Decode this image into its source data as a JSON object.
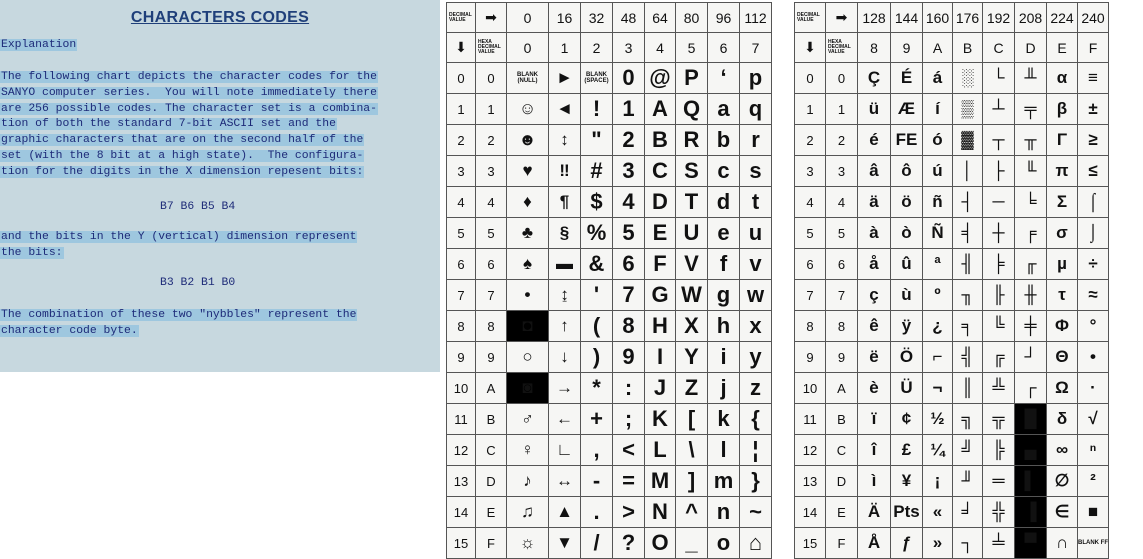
{
  "left": {
    "title": "CHARACTERS CODES",
    "subtitle": "Explanation",
    "para1_lines": [
      "The following chart depicts the character codes for the",
      "SANYO computer series.  You will note immediately there",
      "are 256 possible codes. The character set is a combina-",
      "tion of both the standard 7-bit ASCII set and the",
      "graphic characters that are on the second half of the",
      "set (with the 8 bit at a high state).  The configura-",
      "tion for the digits in the X dimension repesent bits:"
    ],
    "bits_x": "B7 B6 B5 B4",
    "para2_lines": [
      "and the bits in the Y (vertical) dimension represent",
      "the bits:"
    ],
    "bits_y": "B3 B2 B1 B0",
    "para3_lines": [
      "The combination of these two \"nybbles\" represent the",
      "character code byte."
    ]
  },
  "table1": {
    "header_label_dec": "DECIMAL VALUE",
    "header_label_hex": "HEXA DECIMAL VALUE",
    "arrow_right": "➡",
    "arrow_down": "⬇",
    "dec_cols": [
      "0",
      "16",
      "32",
      "48",
      "64",
      "80",
      "96",
      "112"
    ],
    "hex_cols": [
      "0",
      "1",
      "2",
      "3",
      "4",
      "5",
      "6",
      "7"
    ],
    "rows": [
      {
        "dec": "0",
        "hex": "0",
        "cells": [
          "BLANK (NULL)",
          "►",
          "BLANK (SPACE)",
          "0",
          "@",
          "P",
          "‘",
          "p"
        ]
      },
      {
        "dec": "1",
        "hex": "1",
        "cells": [
          "☺",
          "◄",
          "!",
          "1",
          "A",
          "Q",
          "a",
          "q"
        ]
      },
      {
        "dec": "2",
        "hex": "2",
        "cells": [
          "☻",
          "↕",
          "\"",
          "2",
          "B",
          "R",
          "b",
          "r"
        ]
      },
      {
        "dec": "3",
        "hex": "3",
        "cells": [
          "♥",
          "‼",
          "#",
          "3",
          "C",
          "S",
          "c",
          "s"
        ]
      },
      {
        "dec": "4",
        "hex": "4",
        "cells": [
          "♦",
          "¶",
          "$",
          "4",
          "D",
          "T",
          "d",
          "t"
        ]
      },
      {
        "dec": "5",
        "hex": "5",
        "cells": [
          "♣",
          "§",
          "%",
          "5",
          "E",
          "U",
          "e",
          "u"
        ]
      },
      {
        "dec": "6",
        "hex": "6",
        "cells": [
          "♠",
          "▬",
          "&",
          "6",
          "F",
          "V",
          "f",
          "v"
        ]
      },
      {
        "dec": "7",
        "hex": "7",
        "cells": [
          "•",
          "↨",
          "'",
          "7",
          "G",
          "W",
          "g",
          "w"
        ]
      },
      {
        "dec": "8",
        "hex": "8",
        "cells": [
          "◘",
          "↑",
          "(",
          "8",
          "H",
          "X",
          "h",
          "x"
        ]
      },
      {
        "dec": "9",
        "hex": "9",
        "cells": [
          "○",
          "↓",
          ")",
          "9",
          "I",
          "Y",
          "i",
          "y"
        ]
      },
      {
        "dec": "10",
        "hex": "A",
        "cells": [
          "◙",
          "→",
          "*",
          ":",
          "J",
          "Z",
          "j",
          "z"
        ]
      },
      {
        "dec": "11",
        "hex": "B",
        "cells": [
          "♂",
          "←",
          "+",
          ";",
          "K",
          "[",
          "k",
          "{"
        ]
      },
      {
        "dec": "12",
        "hex": "C",
        "cells": [
          "♀",
          "∟",
          ",",
          "<",
          "L",
          "\\",
          "l",
          "¦"
        ]
      },
      {
        "dec": "13",
        "hex": "D",
        "cells": [
          "♪",
          "↔",
          "-",
          "=",
          "M",
          "]",
          "m",
          "}"
        ]
      },
      {
        "dec": "14",
        "hex": "E",
        "cells": [
          "♫",
          "▲",
          ".",
          ">",
          "N",
          "^",
          "n",
          "~"
        ]
      },
      {
        "dec": "15",
        "hex": "F",
        "cells": [
          "☼",
          "▼",
          "/",
          "?",
          "O",
          "_",
          "o",
          "⌂"
        ]
      }
    ]
  },
  "table2": {
    "header_label_dec": "DECIMAL VALUE",
    "header_label_hex": "HEXA DECIMAL VALUE",
    "arrow_right": "➡",
    "arrow_down": "⬇",
    "dec_cols": [
      "128",
      "144",
      "160",
      "176",
      "192",
      "208",
      "224",
      "240"
    ],
    "hex_cols": [
      "8",
      "9",
      "A",
      "B",
      "C",
      "D",
      "E",
      "F"
    ],
    "rows": [
      {
        "dec": "0",
        "hex": "0",
        "cells": [
          "Ç",
          "É",
          "á",
          "░",
          "└",
          "╨",
          "α",
          "≡"
        ]
      },
      {
        "dec": "1",
        "hex": "1",
        "cells": [
          "ü",
          "Æ",
          "í",
          "▒",
          "┴",
          "╤",
          "β",
          "±"
        ]
      },
      {
        "dec": "2",
        "hex": "2",
        "cells": [
          "é",
          "FE",
          "ó",
          "▓",
          "┬",
          "╥",
          "Γ",
          "≥"
        ]
      },
      {
        "dec": "3",
        "hex": "3",
        "cells": [
          "â",
          "ô",
          "ú",
          "│",
          "├",
          "╙",
          "π",
          "≤"
        ]
      },
      {
        "dec": "4",
        "hex": "4",
        "cells": [
          "ä",
          "ö",
          "ñ",
          "┤",
          "─",
          "╘",
          "Σ",
          "⌠"
        ]
      },
      {
        "dec": "5",
        "hex": "5",
        "cells": [
          "à",
          "ò",
          "Ñ",
          "╡",
          "┼",
          "╒",
          "σ",
          "⌡"
        ]
      },
      {
        "dec": "6",
        "hex": "6",
        "cells": [
          "å",
          "û",
          "ª",
          "╢",
          "╞",
          "╓",
          "µ",
          "÷"
        ]
      },
      {
        "dec": "7",
        "hex": "7",
        "cells": [
          "ç",
          "ù",
          "º",
          "╖",
          "╟",
          "╫",
          "τ",
          "≈"
        ]
      },
      {
        "dec": "8",
        "hex": "8",
        "cells": [
          "ê",
          "ÿ",
          "¿",
          "╕",
          "╚",
          "╪",
          "Φ",
          "°"
        ]
      },
      {
        "dec": "9",
        "hex": "9",
        "cells": [
          "ë",
          "Ö",
          "⌐",
          "╣",
          "╔",
          "┘",
          "Θ",
          "•"
        ]
      },
      {
        "dec": "10",
        "hex": "A",
        "cells": [
          "è",
          "Ü",
          "¬",
          "║",
          "╩",
          "┌",
          "Ω",
          "·"
        ]
      },
      {
        "dec": "11",
        "hex": "B",
        "cells": [
          "ï",
          "¢",
          "½",
          "╗",
          "╦",
          "█",
          "δ",
          "√"
        ]
      },
      {
        "dec": "12",
        "hex": "C",
        "cells": [
          "î",
          "£",
          "¼",
          "╝",
          "╠",
          "▄",
          "∞",
          "ⁿ"
        ]
      },
      {
        "dec": "13",
        "hex": "D",
        "cells": [
          "ì",
          "¥",
          "¡",
          "╜",
          "═",
          "▌",
          "∅",
          "²"
        ]
      },
      {
        "dec": "14",
        "hex": "E",
        "cells": [
          "Ä",
          "Pts",
          "«",
          "╛",
          "╬",
          "▐",
          "∈",
          "■"
        ]
      },
      {
        "dec": "15",
        "hex": "F",
        "cells": [
          "Å",
          "ƒ",
          "»",
          "┐",
          "╧",
          "▀",
          "∩",
          "BLANK FF"
        ]
      }
    ]
  }
}
